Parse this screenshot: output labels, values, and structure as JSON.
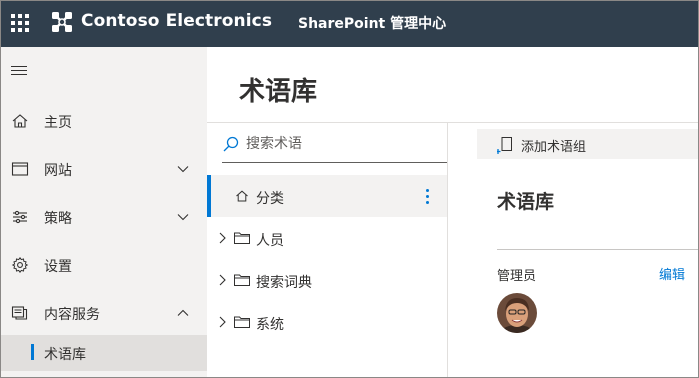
{
  "topbar": {
    "brand": "Contoso Electronics",
    "app_name": "SharePoint 管理中心"
  },
  "leftnav": {
    "items": [
      {
        "label": "主页",
        "icon": "home-icon"
      },
      {
        "label": "网站",
        "icon": "sites-icon",
        "chevron": "down"
      },
      {
        "label": "策略",
        "icon": "policies-icon",
        "chevron": "down"
      },
      {
        "label": "设置",
        "icon": "settings-icon"
      },
      {
        "label": "内容服务",
        "icon": "content-services-icon",
        "chevron": "up"
      }
    ],
    "sub_item": {
      "label": "术语库",
      "selected": true
    }
  },
  "page": {
    "title": "术语库"
  },
  "search": {
    "placeholder": "搜索术语",
    "value": ""
  },
  "tree": {
    "selected": {
      "label": "分类",
      "icon": "home-icon"
    },
    "items": [
      {
        "label": "人员",
        "icon": "folder-icon"
      },
      {
        "label": "搜索词典",
        "icon": "folder-icon"
      },
      {
        "label": "系统",
        "icon": "folder-icon"
      }
    ]
  },
  "detail": {
    "command": "添加术语组",
    "title": "术语库",
    "admin_label": "管理员",
    "edit_label": "编辑"
  },
  "colors": {
    "topbar": "#303f4d",
    "accent": "#0078d4",
    "nav_bg": "#f3f2f1",
    "nav_selected_bg": "#e1dfdd"
  }
}
